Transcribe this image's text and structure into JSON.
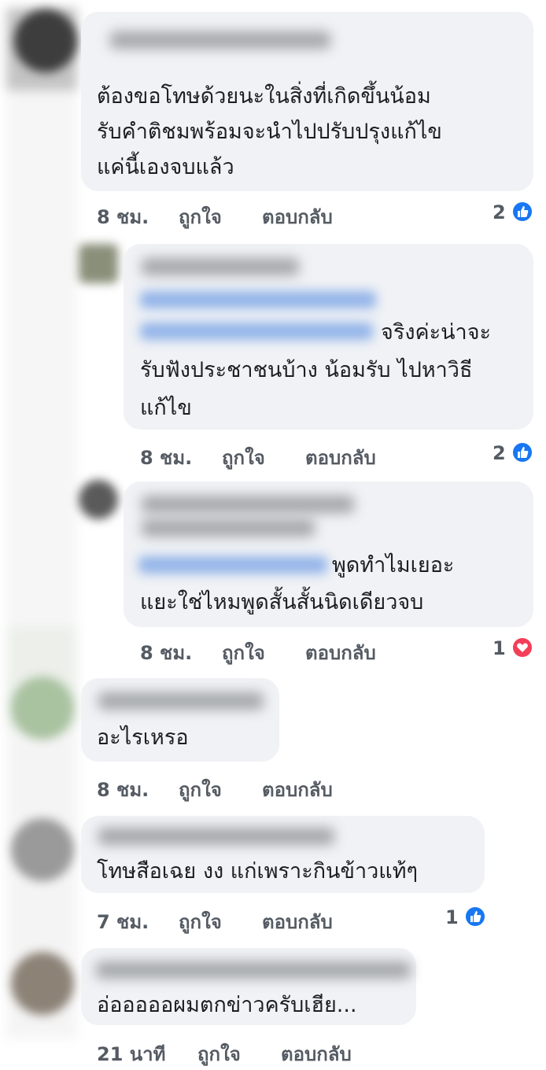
{
  "comments": [
    {
      "body_lines": [
        "ต้องขอโทษด้วยนะในสิ่งที่เกิดขึ้นน้อม",
        "รับคำติชมพร้อมจะนำไปปรับปรุงแก้ไข",
        "แค่นี้เองจบแล้ว"
      ],
      "time": "8 ชม.",
      "like": "ถูกใจ",
      "reply": "ตอบกลับ",
      "reaction": {
        "count": "2",
        "type": "like"
      }
    },
    {
      "body_lines": [
        "จริงค่ะน่าจะ",
        "รับฟังประชาชนบ้าง น้อมรับ ไปหาวิธี",
        "แก้ไข"
      ],
      "time": "8 ชม.",
      "like": "ถูกใจ",
      "reply": "ตอบกลับ",
      "reaction": {
        "count": "2",
        "type": "like"
      }
    },
    {
      "body_lines": [
        "พูดทำไมเยอะ",
        "แยะใช่ไหมพูดสั้นสั้นนิดเดียวจบ"
      ],
      "time": "8 ชม.",
      "like": "ถูกใจ",
      "reply": "ตอบกลับ",
      "reaction": {
        "count": "1",
        "type": "love"
      }
    },
    {
      "body_lines": [
        "อะไรเหรอ"
      ],
      "time": "8 ชม.",
      "like": "ถูกใจ",
      "reply": "ตอบกลับ"
    },
    {
      "body_lines": [
        "โทษสือเฉย งง แก่เพราะกินข้าวแท้ๆ"
      ],
      "time": "7 ชม.",
      "like": "ถูกใจ",
      "reply": "ตอบกลับ",
      "reaction": {
        "count": "1",
        "type": "like"
      }
    },
    {
      "body_lines": [
        "อ่อออออผมตกข่าวครับเฮีย..."
      ],
      "time": "21 นาที",
      "like": "ถูกใจ",
      "reply": "ตอบกลับ"
    }
  ],
  "colors": {
    "bubble": "#f0f2f5",
    "like": "#1877f2",
    "love": "#f33e58",
    "meta": "#555b63"
  },
  "icons": {
    "like": "thumbs-up-icon",
    "love": "heart-icon"
  }
}
